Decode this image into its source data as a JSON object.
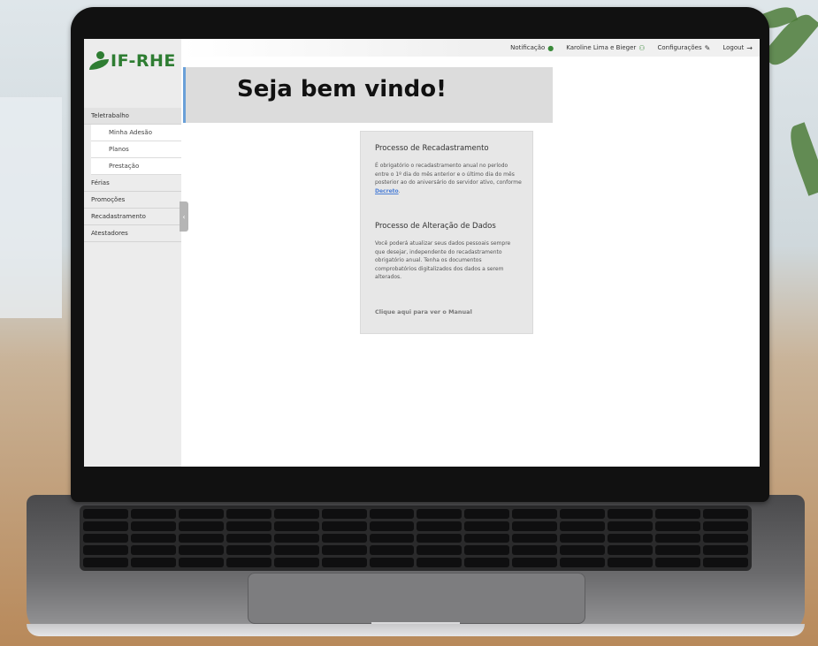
{
  "app": {
    "logo_text": "IF-RHE"
  },
  "topbar": {
    "notification_label": "Notificação",
    "user_label": "Karoline Lima e Bieger",
    "settings_label": "Configurações",
    "logout_label": "Logout"
  },
  "sidebar": {
    "items": [
      {
        "label": "Teletrabalho"
      },
      {
        "label": "Férias"
      },
      {
        "label": "Promoções"
      },
      {
        "label": "Recadastramento"
      },
      {
        "label": "Atestadores"
      }
    ],
    "submenu": [
      {
        "label": "Minha Adesão"
      },
      {
        "label": "Planos"
      },
      {
        "label": "Prestação"
      }
    ]
  },
  "main": {
    "welcome_title": "Seja bem vindo!",
    "card": {
      "section1_title": "Processo de Recadastramento",
      "section1_text": "É obrigatório o recadastramento anual no período entre o 1º dia do mês anterior e o último dia do mês posterior ao do aniversário do servidor ativo, conforme",
      "section1_link": "Decreto",
      "section2_title": "Processo de Alteração de Dados",
      "section2_text": "Você poderá atualizar seus dados pessoais sempre que desejar, independente do recadastramento obrigatório anual. Tenha os documentos comprobatórios digitalizados dos dados a serem alterados.",
      "manual_link": "Clique aqui para ver o Manual"
    }
  }
}
